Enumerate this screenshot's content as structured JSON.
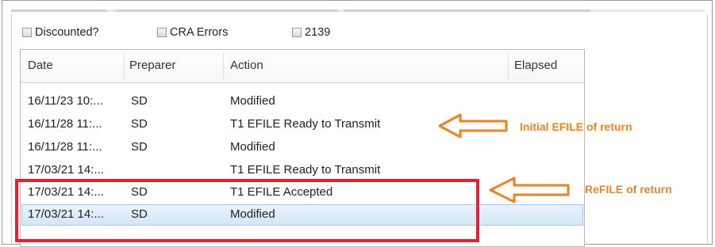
{
  "filters": {
    "discounted_label": "Discounted?",
    "cra_errors_label": "CRA Errors",
    "form2139_label": "2139"
  },
  "grid": {
    "columns": [
      "Date",
      "Preparer",
      "Action",
      "Elapsed"
    ],
    "rows": [
      {
        "date": "16/11/23 10:...",
        "preparer": "SD",
        "action": "Modified",
        "selected": false
      },
      {
        "date": "16/11/28 11:...",
        "preparer": "SD",
        "action": "T1 EFILE Ready to Transmit",
        "selected": false
      },
      {
        "date": "16/11/28 11:...",
        "preparer": "SD",
        "action": "Modified",
        "selected": false
      },
      {
        "date": "17/03/21 14:...",
        "preparer": "",
        "action": "T1 EFILE Ready to Transmit",
        "selected": false
      },
      {
        "date": "17/03/21 14:...",
        "preparer": "SD",
        "action": "T1 EFILE Accepted",
        "selected": false
      },
      {
        "date": "17/03/21 14:...",
        "preparer": "SD",
        "action": "Modified",
        "selected": true
      }
    ]
  },
  "annotations": {
    "initial_efile": "Initial EFILE of return",
    "refile": "ReFILE of return",
    "accent_color": "#f2811d",
    "highlight_color": "#e0232e"
  },
  "colors": {
    "selected_row": "#d4e6f8"
  },
  "icons": {
    "arrow": "left-arrow-outline"
  }
}
